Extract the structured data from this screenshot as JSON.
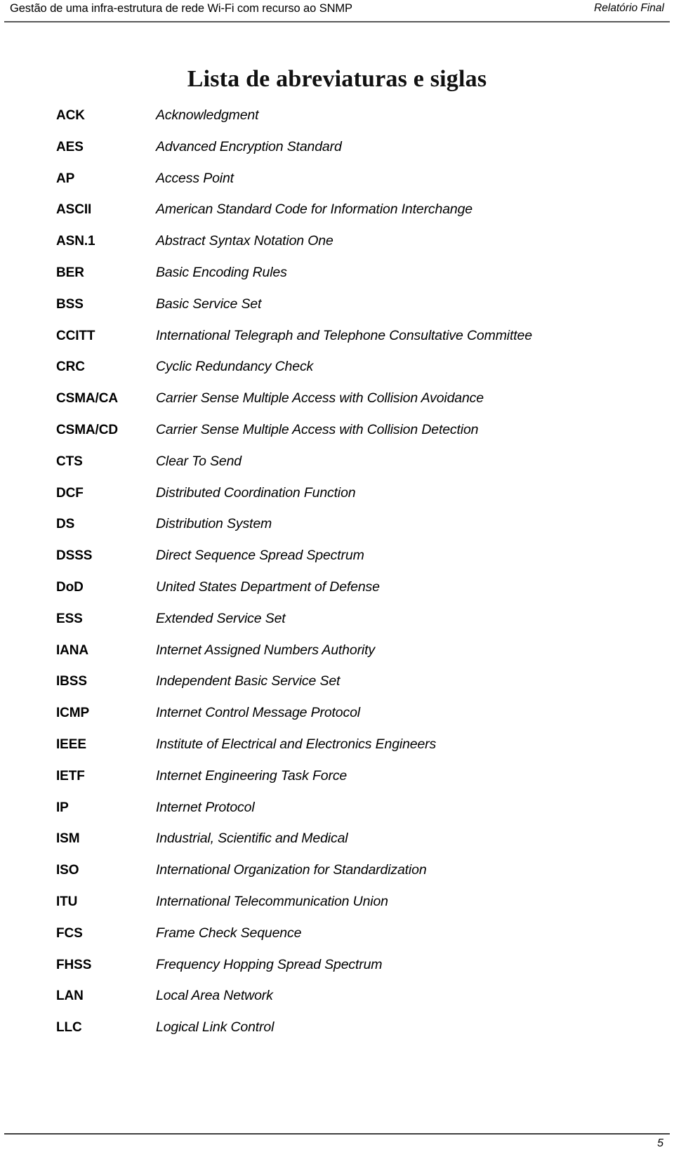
{
  "header": {
    "title": "Gestão de uma infra-estrutura de rede Wi-Fi com recurso ao SNMP",
    "right_label": "Relatório Final"
  },
  "page_title": "Lista de abreviaturas e siglas",
  "abbreviations": [
    {
      "term": "ACK",
      "definition": "Acknowledgment"
    },
    {
      "term": "AES",
      "definition": "Advanced Encryption Standard"
    },
    {
      "term": "AP",
      "definition": "Access Point"
    },
    {
      "term": "ASCII",
      "definition": "American Standard Code for Information Interchange"
    },
    {
      "term": "ASN.1",
      "definition": "Abstract Syntax Notation One"
    },
    {
      "term": "BER",
      "definition": "Basic Encoding Rules"
    },
    {
      "term": "BSS",
      "definition": "Basic Service Set"
    },
    {
      "term": "CCITT",
      "definition": "International Telegraph and Telephone Consultative Committee"
    },
    {
      "term": "CRC",
      "definition": "Cyclic Redundancy Check"
    },
    {
      "term": "CSMA/CA",
      "definition": "Carrier Sense Multiple Access with Collision Avoidance"
    },
    {
      "term": "CSMA/CD",
      "definition": "Carrier Sense Multiple Access with Collision Detection"
    },
    {
      "term": "CTS",
      "definition": "Clear To Send"
    },
    {
      "term": "DCF",
      "definition": "Distributed Coordination Function"
    },
    {
      "term": "DS",
      "definition": "Distribution System"
    },
    {
      "term": "DSSS",
      "definition": "Direct Sequence Spread Spectrum"
    },
    {
      "term": "DoD",
      "definition": "United States Department of Defense"
    },
    {
      "term": "ESS",
      "definition": "Extended Service Set"
    },
    {
      "term": "IANA",
      "definition": "Internet Assigned Numbers Authority"
    },
    {
      "term": "IBSS",
      "definition": "Independent Basic Service Set"
    },
    {
      "term": "ICMP",
      "definition": "Internet Control Message Protocol"
    },
    {
      "term": "IEEE",
      "definition": "Institute of Electrical and Electronics Engineers"
    },
    {
      "term": "IETF",
      "definition": "Internet Engineering Task Force"
    },
    {
      "term": "IP",
      "definition": "Internet Protocol"
    },
    {
      "term": "ISM",
      "definition": "Industrial, Scientific and Medical"
    },
    {
      "term": "ISO",
      "definition": "International Organization for Standardization"
    },
    {
      "term": "ITU",
      "definition": "International Telecommunication Union"
    },
    {
      "term": "FCS",
      "definition": "Frame Check Sequence"
    },
    {
      "term": "FHSS",
      "definition": "Frequency Hopping Spread Spectrum"
    },
    {
      "term": "LAN",
      "definition": "Local Area Network"
    },
    {
      "term": "LLC",
      "definition": "Logical Link Control"
    }
  ],
  "footer": {
    "page_number": "5"
  }
}
